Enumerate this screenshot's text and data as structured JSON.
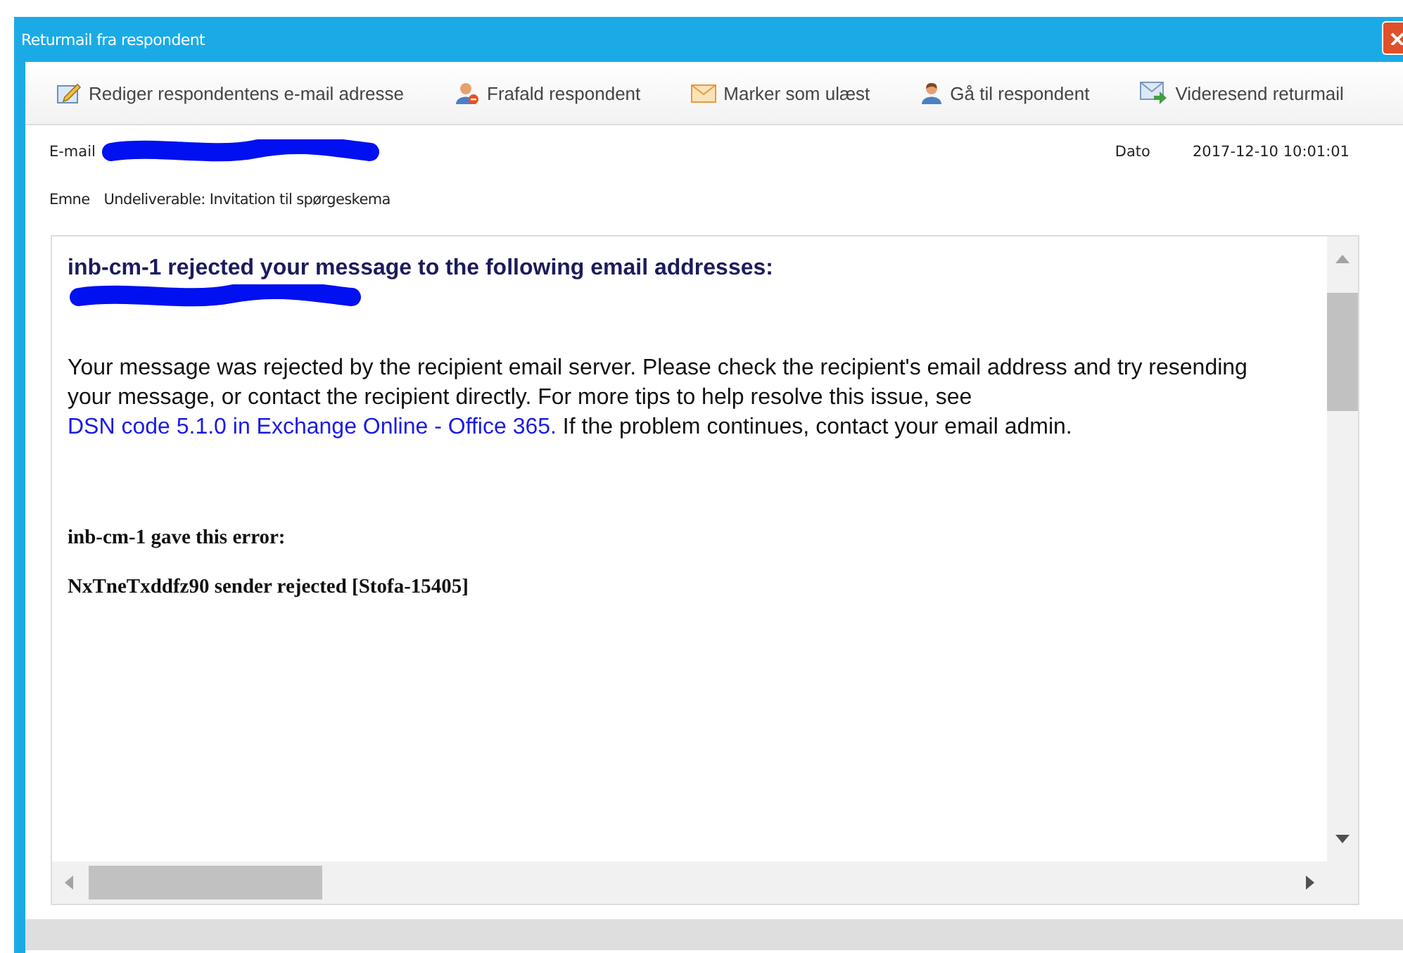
{
  "window": {
    "title": "Returmail fra respondent"
  },
  "toolbar": [
    {
      "kind": "edit",
      "label": "Rediger respondentens e-mail adresse"
    },
    {
      "kind": "withdraw",
      "label": "Frafald respondent"
    },
    {
      "kind": "unread",
      "label": "Marker som ulæst"
    },
    {
      "kind": "open",
      "label": "Gå til respondent"
    },
    {
      "kind": "forward",
      "label": "Videresend returmail"
    }
  ],
  "header": {
    "email_label": "E-mail",
    "date_label": "Dato",
    "date": "2017-12-10 10:01:01",
    "subject_label": "Emne",
    "subject": "Undeliverable: Invitation til spørgeskema"
  },
  "message": {
    "heading": "inb-cm-1 rejected your message to the following email addresses:",
    "body_before": "Your message was rejected by the recipient email server. Please check the recipient's email address and try resending your message, or contact the recipient directly. For more tips to help resolve this issue, see ",
    "link": "DSN code 5.1.0 in Exchange Online - Office 365.",
    "body_after": " If the problem continues, contact your email admin.",
    "error_intro": "inb-cm-1 gave this error:",
    "error": "NxTneTxddfz90 sender rejected [Stofa-15405]"
  }
}
